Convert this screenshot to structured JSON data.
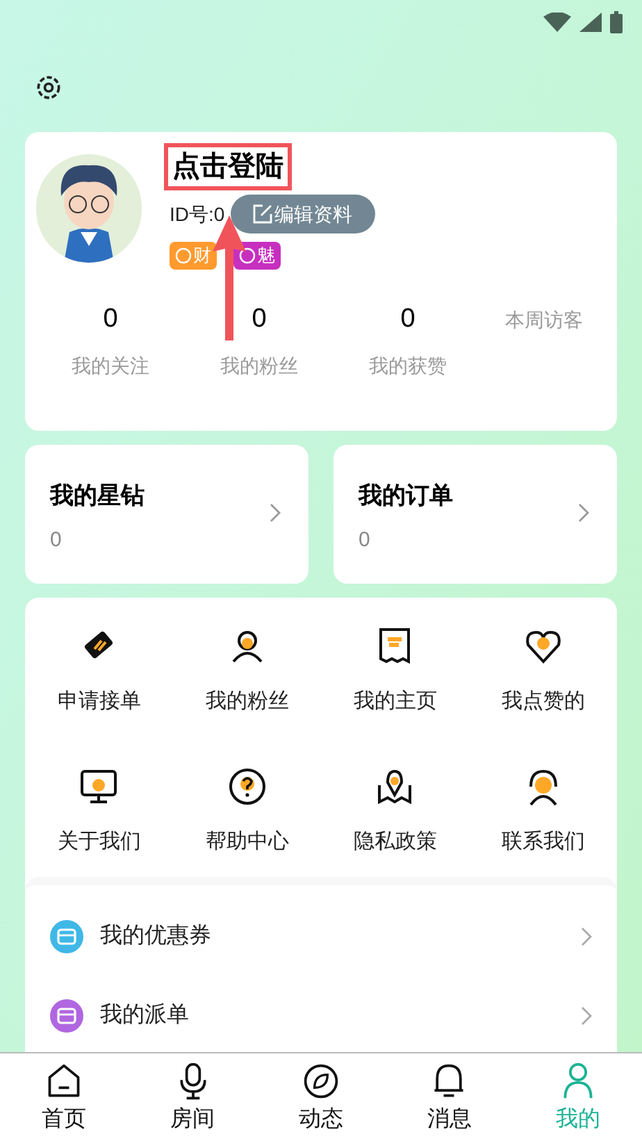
{
  "profile": {
    "name": "点击登陆",
    "id_label": "ID号:0",
    "edit_button": "编辑资料",
    "badges": [
      {
        "label": "财",
        "color": "#ff9a2e"
      },
      {
        "label": "魅",
        "color": "#c72fbf"
      }
    ]
  },
  "stats": [
    {
      "value": "0",
      "label": "我的关注"
    },
    {
      "value": "0",
      "label": "我的粉丝"
    },
    {
      "value": "0",
      "label": "我的获赞"
    }
  ],
  "weekly_visitors": "本周访客",
  "summary_cards": [
    {
      "title": "我的星钻",
      "value": "0"
    },
    {
      "title": "我的订单",
      "value": "0"
    }
  ],
  "grid": [
    {
      "kind": "ticket",
      "label": "申请接单"
    },
    {
      "kind": "person",
      "label": "我的粉丝"
    },
    {
      "kind": "receipt",
      "label": "我的主页"
    },
    {
      "kind": "heart",
      "label": "我点赞的"
    },
    {
      "kind": "monitor",
      "label": "关于我们"
    },
    {
      "kind": "help",
      "label": "帮助中心"
    },
    {
      "kind": "map",
      "label": "隐私政策"
    },
    {
      "kind": "support",
      "label": "联系我们"
    }
  ],
  "list": [
    {
      "label": "我的优惠券",
      "color": "#3fb8e8"
    },
    {
      "label": "我的派单",
      "color": "#b066e0"
    }
  ],
  "tabs": [
    {
      "kind": "home",
      "label": "首页",
      "selected": false
    },
    {
      "kind": "mic",
      "label": "房间",
      "selected": false
    },
    {
      "kind": "compass",
      "label": "动态",
      "selected": false
    },
    {
      "kind": "bell",
      "label": "消息",
      "selected": false
    },
    {
      "kind": "me",
      "label": "我的",
      "selected": true
    }
  ]
}
